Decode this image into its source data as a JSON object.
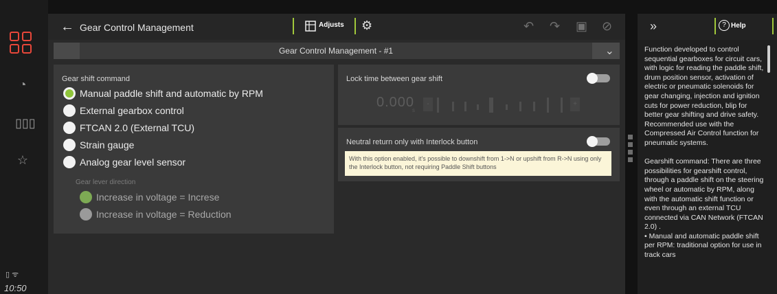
{
  "app": {
    "title": "Gear Control Management",
    "subtitle": "Gear Control Management - #1",
    "tab_adjusts": "Adjusts",
    "clock": "10:50"
  },
  "left_card": {
    "header": "Gear shift command",
    "options": [
      {
        "label": "Manual paddle shift and automatic by RPM",
        "selected": true
      },
      {
        "label": "External gearbox control",
        "selected": false
      },
      {
        "label": "FTCAN 2.0 (External TCU)",
        "selected": false
      },
      {
        "label": "Strain gauge",
        "selected": false
      },
      {
        "label": "Analog gear level sensor",
        "selected": false
      }
    ],
    "sub_header": "Gear lever direction",
    "sub_options": [
      {
        "label": "Increase in voltage = Increse",
        "selected": true
      },
      {
        "label": "Increase in voltage = Reduction",
        "selected": false
      }
    ]
  },
  "lock_card": {
    "header": "Lock time between gear shift",
    "value": "0.000",
    "unit": "s",
    "minus": "-",
    "plus": "+",
    "enabled": false
  },
  "neutral_card": {
    "header": "Neutral return only with Interlock button",
    "note": "With this option enabled, it's possible to downshift from 1->N or upshift from R->N using only the Interlock button, not requiring Paddle Shift buttons",
    "enabled": false
  },
  "help": {
    "button": "Help",
    "text": "Function developed to control sequential gearboxes for circuit cars, with logic for reading the paddle shift, drum position sensor, activation of electric or pneumatic solenoids for gear changing, injection and ignition cuts for power reduction, blip for better gear shifting and drive safety. Recommended use with the Compressed Air Control function for pneumatic systems.\n\nGearshift command: There are three possibilities for gearshift control, through a paddle shift on the steering wheel or automatic by RPM, along with the automatic shift function or even through an external TCU connected via CAN Network (FTCAN 2.0) .\n• Manual and automatic paddle shift per RPM: traditional option for use in track cars"
  },
  "colors": {
    "accent": "#a2c93b",
    "brand": "#e8473a",
    "selected_radio": "#8fc53a"
  }
}
